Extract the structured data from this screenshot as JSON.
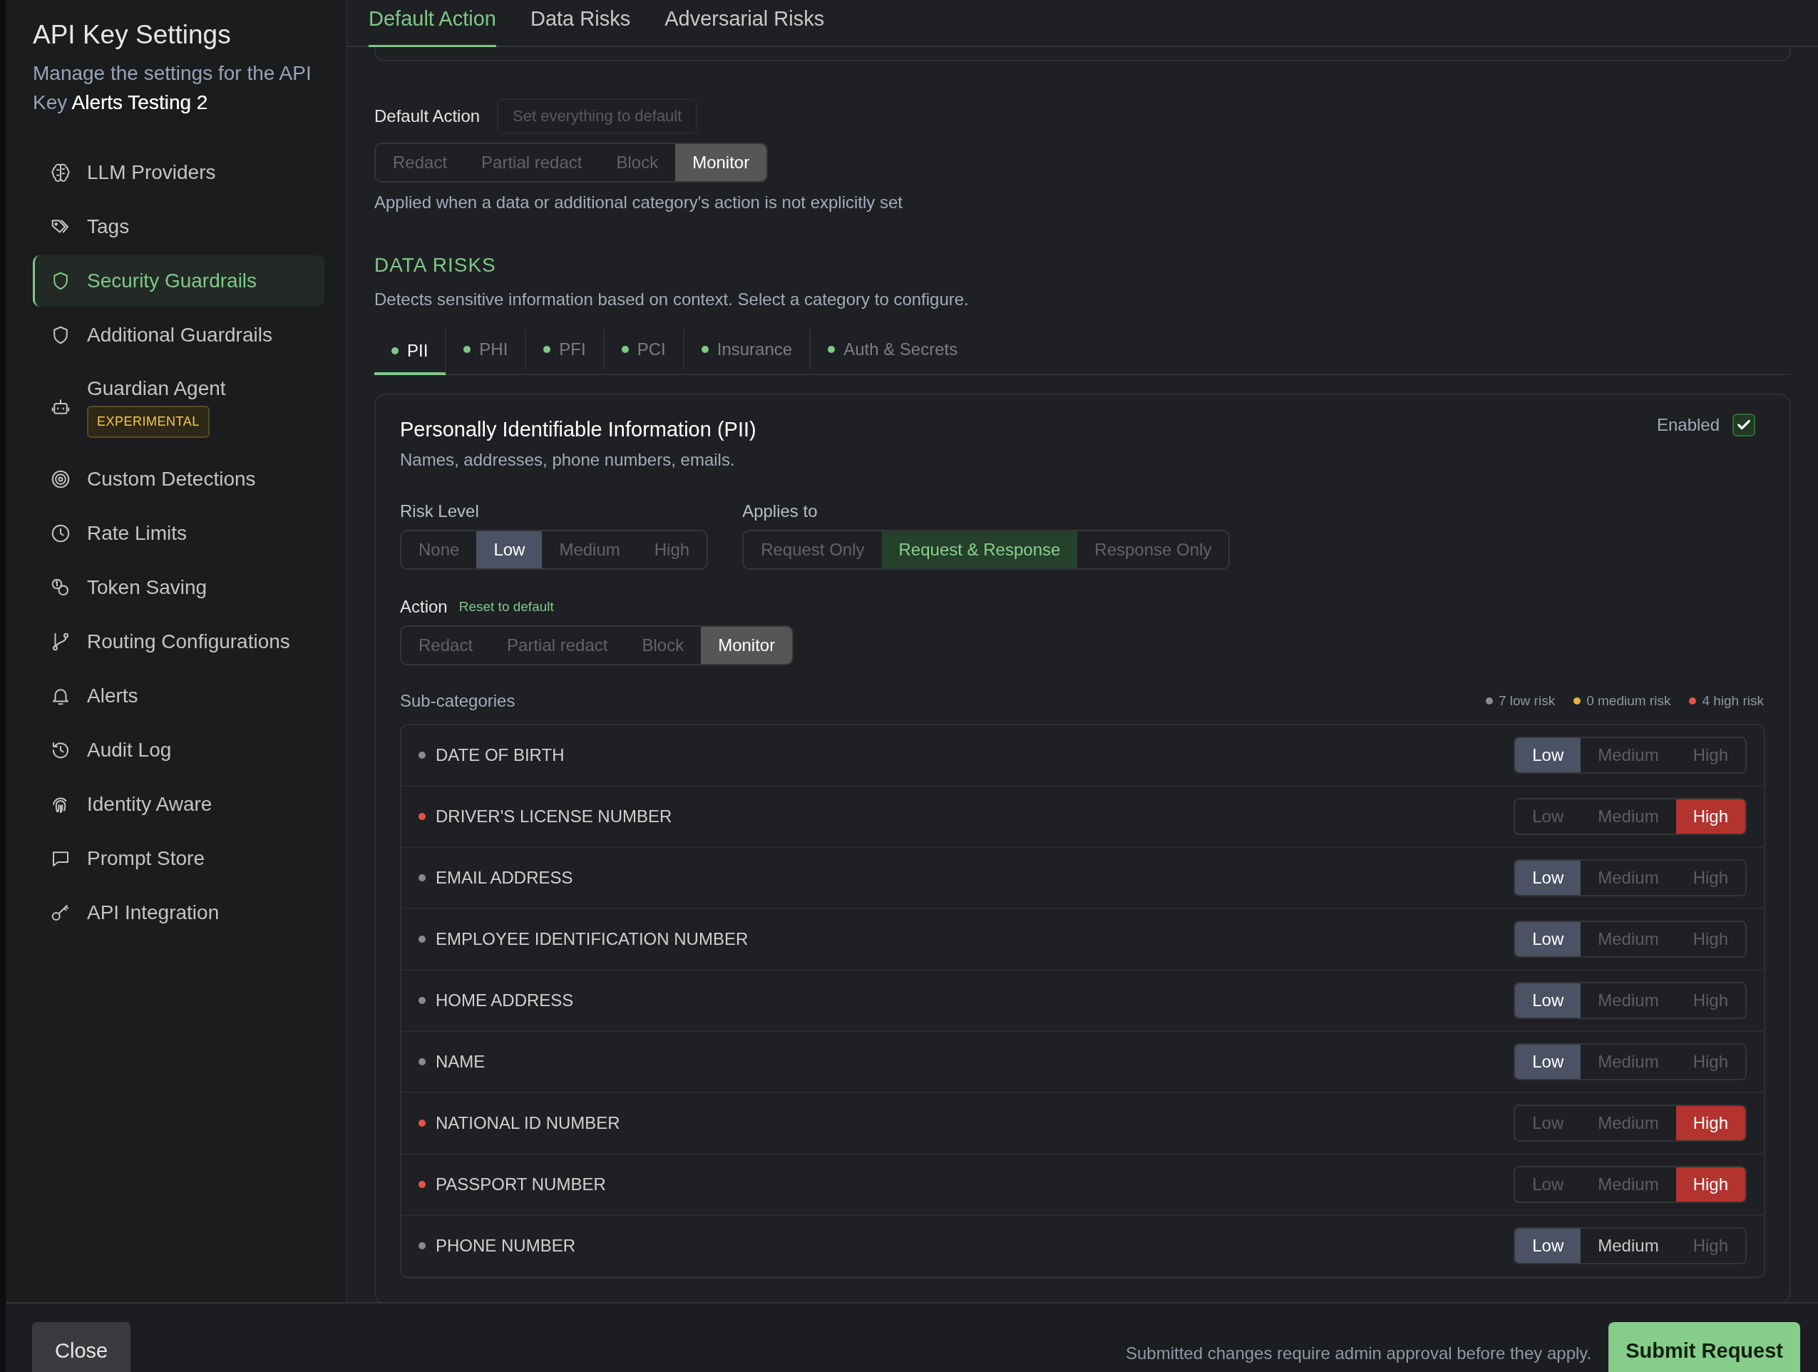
{
  "sidebar": {
    "title": "API Key Settings",
    "subtitle": "Manage the settings for the API Key **Alerts Testing 2**",
    "items": [
      {
        "label": "LLM Providers",
        "selected": false
      },
      {
        "label": "Tags",
        "selected": false
      },
      {
        "label": "Security Guardrails",
        "selected": true
      },
      {
        "label": "Additional Guardrails",
        "selected": false
      },
      {
        "label": "Guardian Agent",
        "selected": false,
        "badge": "EXPERIMENTAL"
      },
      {
        "label": "Custom Detections",
        "selected": false
      },
      {
        "label": "Rate Limits",
        "selected": false
      },
      {
        "label": "Token Saving",
        "selected": false
      },
      {
        "label": "Routing Configurations",
        "selected": false
      },
      {
        "label": "Alerts",
        "selected": false
      },
      {
        "label": "Audit Log",
        "selected": false
      },
      {
        "label": "Identity Aware",
        "selected": false
      },
      {
        "label": "Prompt Store",
        "selected": false
      },
      {
        "label": "API Integration",
        "selected": false
      }
    ]
  },
  "tabs": [
    {
      "label": "Default Action",
      "selected": true
    },
    {
      "label": "Data Risks",
      "selected": false
    },
    {
      "label": "Adversarial Risks",
      "selected": false
    }
  ],
  "default_action": {
    "label": "Default Action",
    "reset_button": {
      "label": "Set everything to default",
      "disabled": true
    },
    "options": [
      {
        "label": "Redact",
        "selected": false
      },
      {
        "label": "Partial redact",
        "selected": false
      },
      {
        "label": "Block",
        "selected": false
      },
      {
        "label": "Monitor",
        "selected": true
      }
    ],
    "note": "Applied when a data or additional category's action is not explicitly set"
  },
  "data_risks": {
    "heading": "DATA RISKS",
    "description": "Detects sensitive information based on context. Select a category to configure.",
    "categories": [
      {
        "label": "PII",
        "selected": true
      },
      {
        "label": "PHI",
        "selected": false
      },
      {
        "label": "PFI",
        "selected": false
      },
      {
        "label": "PCI",
        "selected": false
      },
      {
        "label": "Insurance",
        "selected": false
      },
      {
        "label": "Auth & Secrets",
        "selected": false
      }
    ],
    "panel": {
      "title": "Personally Identifiable Information (PII)",
      "description": "Names, addresses, phone numbers, emails.",
      "enabled": {
        "label": "Enabled",
        "checked": true
      },
      "risk_level": {
        "label": "Risk Level",
        "options": [
          {
            "label": "None",
            "selected": false
          },
          {
            "label": "Low",
            "selected": true
          },
          {
            "label": "Medium",
            "selected": false
          },
          {
            "label": "High",
            "selected": false
          }
        ]
      },
      "applies_to": {
        "label": "Applies to",
        "options": [
          {
            "label": "Request Only",
            "selected": false
          },
          {
            "label": "Request & Response",
            "selected": true
          },
          {
            "label": "Response Only",
            "selected": false
          }
        ]
      },
      "action": {
        "label": "Action",
        "reset_link": "Reset to default",
        "options": [
          {
            "label": "Redact",
            "selected": false
          },
          {
            "label": "Partial redact",
            "selected": false
          },
          {
            "label": "Block",
            "selected": false
          },
          {
            "label": "Monitor",
            "selected": true
          }
        ]
      },
      "subcategories": {
        "label": "Sub-categories",
        "legend": [
          {
            "text": "7 low risk",
            "color": "#8a8a8a"
          },
          {
            "text": "0 medium risk",
            "color": "#e0b43a"
          },
          {
            "text": "4 high risk",
            "color": "#e5534b"
          }
        ],
        "rows": [
          {
            "name": "DATE OF BIRTH",
            "color": "#8a8a8a",
            "levels": [
              {
                "kind": "low",
                "label": "Low",
                "selected": true
              },
              {
                "kind": "medium",
                "label": "Medium",
                "selected": false
              },
              {
                "kind": "high",
                "label": "High",
                "selected": false
              }
            ]
          },
          {
            "name": "DRIVER'S LICENSE NUMBER",
            "color": "#e5534b",
            "levels": [
              {
                "kind": "low",
                "label": "Low",
                "selected": false
              },
              {
                "kind": "medium",
                "label": "Medium",
                "selected": false
              },
              {
                "kind": "high",
                "label": "High",
                "selected": true
              }
            ]
          },
          {
            "name": "EMAIL ADDRESS",
            "color": "#8a8a8a",
            "levels": [
              {
                "kind": "low",
                "label": "Low",
                "selected": true
              },
              {
                "kind": "medium",
                "label": "Medium",
                "selected": false
              },
              {
                "kind": "high",
                "label": "High",
                "selected": false
              }
            ]
          },
          {
            "name": "EMPLOYEE IDENTIFICATION NUMBER",
            "color": "#8a8a8a",
            "levels": [
              {
                "kind": "low",
                "label": "Low",
                "selected": true
              },
              {
                "kind": "medium",
                "label": "Medium",
                "selected": false
              },
              {
                "kind": "high",
                "label": "High",
                "selected": false
              }
            ]
          },
          {
            "name": "HOME ADDRESS",
            "color": "#8a8a8a",
            "levels": [
              {
                "kind": "low",
                "label": "Low",
                "selected": true
              },
              {
                "kind": "medium",
                "label": "Medium",
                "selected": false
              },
              {
                "kind": "high",
                "label": "High",
                "selected": false
              }
            ]
          },
          {
            "name": "NAME",
            "color": "#8a8a8a",
            "levels": [
              {
                "kind": "low",
                "label": "Low",
                "selected": true
              },
              {
                "kind": "medium",
                "label": "Medium",
                "selected": false
              },
              {
                "kind": "high",
                "label": "High",
                "selected": false
              }
            ]
          },
          {
            "name": "NATIONAL ID NUMBER",
            "color": "#e5534b",
            "levels": [
              {
                "kind": "low",
                "label": "Low",
                "selected": false
              },
              {
                "kind": "medium",
                "label": "Medium",
                "selected": false
              },
              {
                "kind": "high",
                "label": "High",
                "selected": true
              }
            ]
          },
          {
            "name": "PASSPORT NUMBER",
            "color": "#e5534b",
            "levels": [
              {
                "kind": "low",
                "label": "Low",
                "selected": false
              },
              {
                "kind": "medium",
                "label": "Medium",
                "selected": false
              },
              {
                "kind": "high",
                "label": "High",
                "selected": true
              }
            ]
          },
          {
            "name": "PHONE NUMBER",
            "color": "#8a8a8a",
            "levels": [
              {
                "kind": "low",
                "label": "Low",
                "selected": true
              },
              {
                "kind": "medium",
                "label": "Medium",
                "selected": false,
                "hovered": true
              },
              {
                "kind": "high",
                "label": "High",
                "selected": false
              }
            ]
          }
        ]
      }
    }
  },
  "footer": {
    "close": "Close",
    "note": "Submitted changes require admin approval before they apply.",
    "submit": "Submit Request"
  }
}
